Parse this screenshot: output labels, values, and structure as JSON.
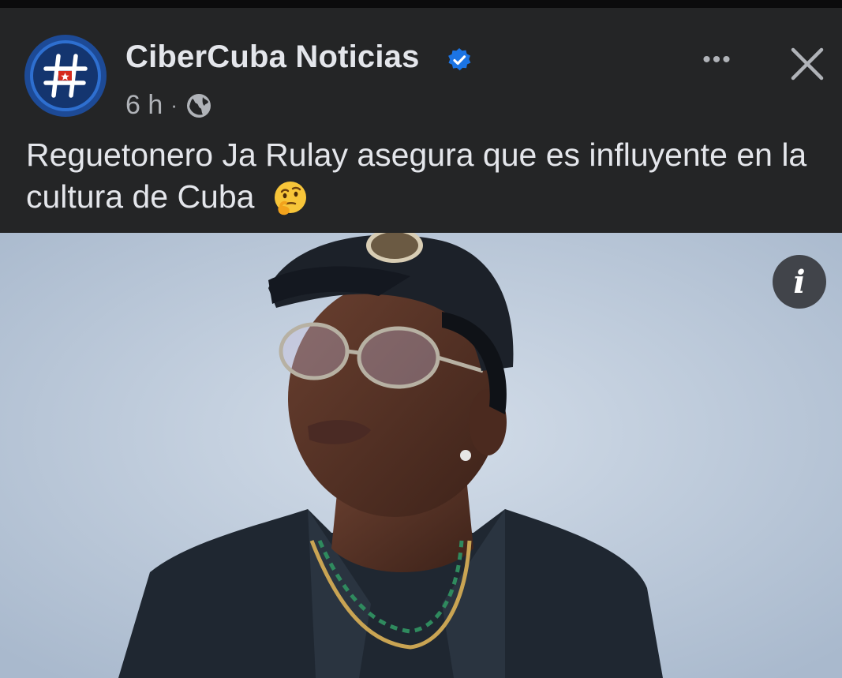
{
  "post": {
    "page_name": "CiberCuba Noticias",
    "verified": true,
    "timestamp": "6 h",
    "separator": "·",
    "audience_icon": "globe-icon",
    "text": "Reguetonero Ja Rulay asegura que es influyente en la cultura de Cuba",
    "emoji": "thinking-face",
    "info_label": "i"
  },
  "actions": {
    "more_label": "•••",
    "close_icon": "close-icon"
  },
  "colors": {
    "background": "#242526",
    "text_primary": "#e4e6eb",
    "text_secondary": "#b0b3b8",
    "verified_blue": "#1b74e4"
  }
}
